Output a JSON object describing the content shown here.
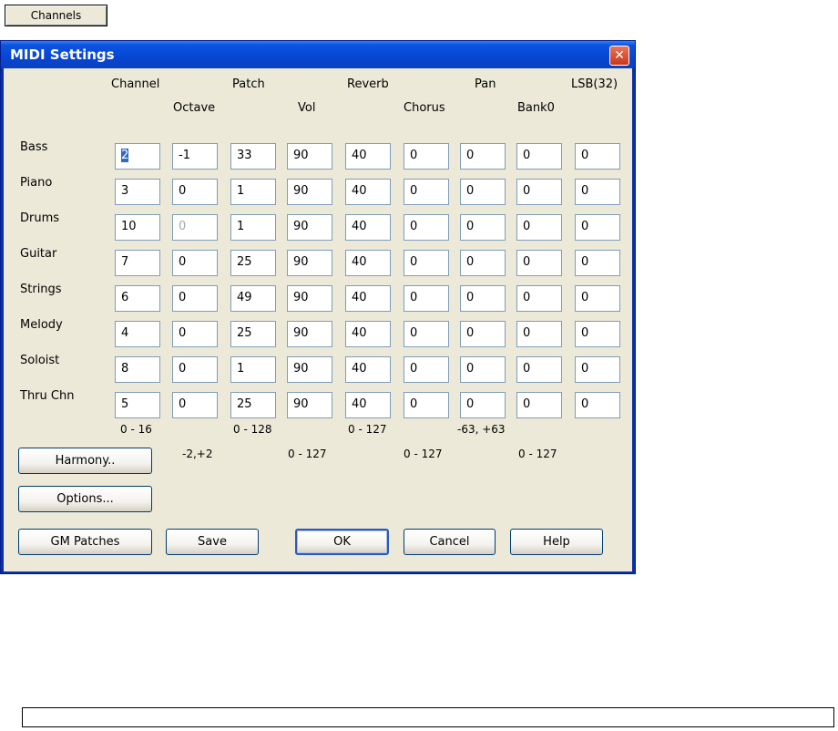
{
  "top_button": "Channels",
  "dialog": {
    "title": "MIDI Settings",
    "close_glyph": "✕"
  },
  "headers": {
    "channel": "Channel",
    "octave": "Octave",
    "patch": "Patch",
    "vol": "Vol",
    "reverb": "Reverb",
    "chorus": "Chorus",
    "pan": "Pan",
    "bank0": "Bank0",
    "lsb32": "LSB(32)"
  },
  "rows": [
    {
      "label": "Bass",
      "values": [
        "2",
        "-1",
        "33",
        "90",
        "40",
        "0",
        "0",
        "0",
        "0"
      ]
    },
    {
      "label": "Piano",
      "values": [
        "3",
        "0",
        "1",
        "90",
        "40",
        "0",
        "0",
        "0",
        "0"
      ]
    },
    {
      "label": "Drums",
      "values": [
        "10",
        "0",
        "1",
        "90",
        "40",
        "0",
        "0",
        "0",
        "0"
      ]
    },
    {
      "label": "Guitar",
      "values": [
        "7",
        "0",
        "25",
        "90",
        "40",
        "0",
        "0",
        "0",
        "0"
      ]
    },
    {
      "label": "Strings",
      "values": [
        "6",
        "0",
        "49",
        "90",
        "40",
        "0",
        "0",
        "0",
        "0"
      ]
    },
    {
      "label": "Melody",
      "values": [
        "4",
        "0",
        "25",
        "90",
        "40",
        "0",
        "0",
        "0",
        "0"
      ]
    },
    {
      "label": "Soloist",
      "values": [
        "8",
        "0",
        "1",
        "90",
        "40",
        "0",
        "0",
        "0",
        "0"
      ]
    },
    {
      "label": "Thru Chn",
      "values": [
        "5",
        "0",
        "25",
        "90",
        "40",
        "0",
        "0",
        "0",
        "0"
      ]
    }
  ],
  "ranges": {
    "channel": "0 - 16",
    "octave": "-2,+2",
    "patch": "0 - 128",
    "vol": "0 - 127",
    "reverb": "0 - 127",
    "chorus": "0 - 127",
    "pan": "-63, +63",
    "bank0": "0 - 127"
  },
  "buttons": {
    "harmony": "Harmony..",
    "options": "Options...",
    "gm_patches": "GM Patches",
    "save": "Save",
    "ok": "OK",
    "cancel": "Cancel",
    "help": "Help"
  }
}
